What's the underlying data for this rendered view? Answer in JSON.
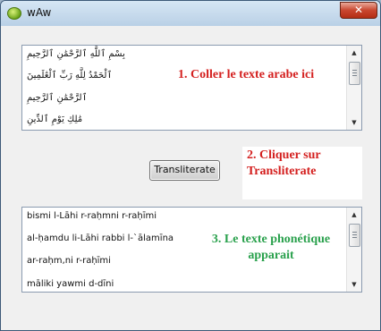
{
  "window": {
    "title": "wAw",
    "close_glyph": "✕"
  },
  "input": {
    "lines": [
      "بِسْمِ ٱللَّهِ ٱلرَّحْمَٰنِ ٱلرَّحِيمِ",
      "ٱلْحَمْدُ لِلَّهِ رَبِّ ٱلْعَٰلَمِينَ",
      "ٱلرَّحْمَٰنِ ٱلرَّحِيمِ",
      "مَٰلِكِ يَوْمِ ٱلدِّينِ"
    ],
    "annotation": "1. Coller le texte arabe ici"
  },
  "action": {
    "button_label": "Transliterate",
    "annotation_line1": "2. Cliquer sur",
    "annotation_line2": "Transliterate"
  },
  "output": {
    "lines": [
      "bismi l-Lāhi r-raḥmni r-raḥīmi",
      "al-ḥamdu li-Lāhi rabbi l-`ālamīna",
      "ar-raḥm‚ni r-raḥīmi",
      "māliki yawmi d-dīni"
    ],
    "annotation_line1": "3. Le texte phonétique",
    "annotation_line2": "apparait"
  },
  "icons": {
    "app": "leaf-app-icon",
    "close": "close-icon",
    "scroll_up": "arrow-up-icon",
    "scroll_down": "arrow-down-icon"
  },
  "colors": {
    "step1": "#d4201f",
    "step2": "#d4201f",
    "step3": "#2aa14d"
  }
}
